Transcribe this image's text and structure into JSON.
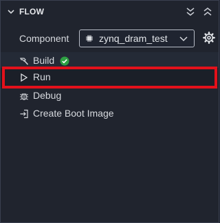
{
  "header": {
    "title": "FLOW"
  },
  "component": {
    "label": "Component",
    "value": "zynq_dram_test"
  },
  "flow": {
    "items": [
      {
        "label": "Build",
        "status": "success"
      },
      {
        "label": "Run"
      },
      {
        "label": "Debug"
      },
      {
        "label": "Create Boot Image"
      }
    ]
  },
  "colors": {
    "background": "#20242e",
    "text": "#d6d9de",
    "success": "#2ea043",
    "highlight": "#e3111b"
  },
  "icons": {
    "header_toggle": "chevron-down-icon",
    "collapse_all": "double-chevron-down-icon",
    "expand_all": "double-chevron-up-icon",
    "component": "chip-icon",
    "settings": "gear-icon",
    "build": "hammer-icon",
    "run": "play-icon",
    "debug": "bug-icon",
    "boot": "sign-in-icon"
  }
}
